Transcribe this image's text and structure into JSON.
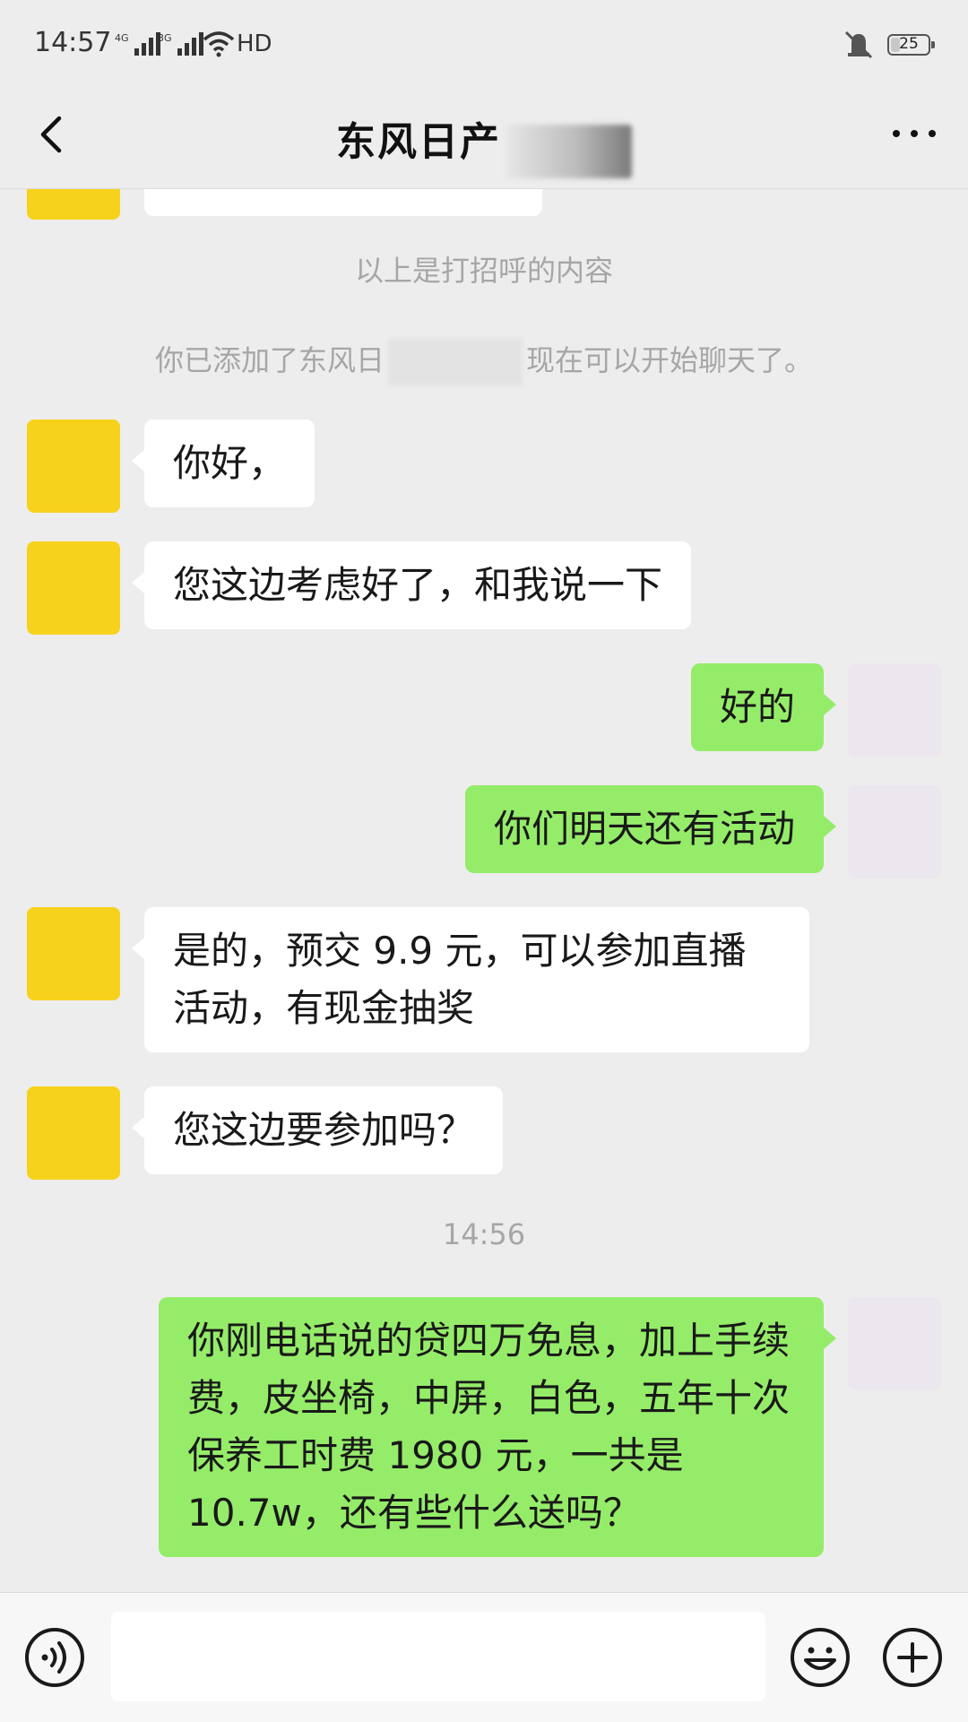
{
  "status_bar": {
    "time": "14:57",
    "net1": "4G",
    "net2": "3G",
    "hd": "HD",
    "battery": "25",
    "battery_level_percent": 25
  },
  "header": {
    "title": "东风日产",
    "back_icon": "chevron-left-icon",
    "more_icon": "more-icon"
  },
  "chat": {
    "sys_greeting_end": "以上是打招呼的内容",
    "sys_added_prefix": "你已添加了东风日",
    "sys_added_suffix": "现在可以开始聊天了。",
    "timestamp": "14:56",
    "messages": [
      {
        "from": "dealer",
        "text": "你好，"
      },
      {
        "from": "dealer",
        "text": "您这边考虑好了，和我说一下"
      },
      {
        "from": "me",
        "text": "好的"
      },
      {
        "from": "me",
        "text": "你们明天还有活动"
      },
      {
        "from": "dealer",
        "text": "是的，预交 9.9 元，可以参加直播活动，有现金抽奖"
      },
      {
        "from": "dealer",
        "text": "您这边要参加吗？"
      },
      {
        "from": "me",
        "text": "你刚电话说的贷四万免息，加上手续费，皮坐椅，中屏，白色，五年十次保养工时费 1980 元，一共是 10.7w，还有些什么送吗？"
      }
    ]
  },
  "input_bar": {
    "voice_icon": "voice-icon",
    "emoji_icon": "emoji-icon",
    "plus_icon": "plus-icon",
    "input_value": ""
  },
  "colors": {
    "background": "#ededed",
    "outgoing_bubble": "#95ec69",
    "incoming_bubble": "#ffffff",
    "system_text": "#a6a6a6"
  }
}
